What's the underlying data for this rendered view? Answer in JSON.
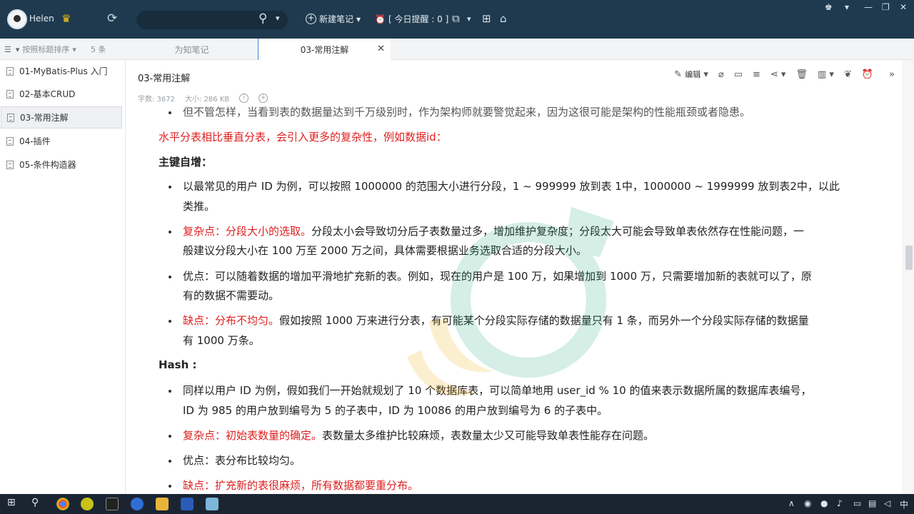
{
  "user": {
    "name": "Helen"
  },
  "header": {
    "new_note_label": "新建笔记",
    "reminder_label": "[ 今日提醒 : 0 ]"
  },
  "sortbar": {
    "sort_label": "按照标题排序",
    "count_label": "5 条"
  },
  "tabs": [
    {
      "label": "为知笔记"
    },
    {
      "label": "03-常用注解"
    }
  ],
  "notes": [
    {
      "label": "01-MyBatis-Plus 入门"
    },
    {
      "label": "02-基本CRUD"
    },
    {
      "label": "03-常用注解"
    },
    {
      "label": "04-插件"
    },
    {
      "label": "05-条件构造器"
    }
  ],
  "document": {
    "title": "03-常用注解",
    "word_count": "字数: 3672",
    "size": "大小: 286 KB",
    "edit_label": "编辑",
    "lines": {
      "l0": "但不管怎样，当看到表的数据量达到千万级别时，作为架构师就要警觉起来，因为这很可能是架构的性能瓶颈或者隐患。",
      "l1": "水平分表相比垂直分表，会引入更多的复杂性，例如数据id：",
      "l2": "主键自增：",
      "l3a": "以最常见的用户 ID 为例，可以按照 1000000 的范围大小进行分段，1 ~ 999999 放到表 1中，1000000 ~ 1999999 放到表2中，以此",
      "l3b": "类推。",
      "l4a_red": "复杂点：分段大小的选取。",
      "l4a": "分段太小会导致切分后子表数量过多，增加维护复杂度；分段太大可能会导致单表依然存在性能问题，一",
      "l4b": "般建议分段大小在 100 万至 2000 万之间，具体需要根据业务选取合适的分段大小。",
      "l5a": "优点：可以随着数据的增加平滑地扩充新的表。例如，现在的用户是 100 万，如果增加到 1000 万，只需要增加新的表就可以了，原",
      "l5b": "有的数据不需要动。",
      "l6a_red": "缺点：分布不均匀。",
      "l6a": "假如按照 1000 万来进行分表，有可能某个分段实际存储的数据量只有 1 条，而另外一个分段实际存储的数据量",
      "l6b": "有 1000 万条。",
      "l7": "Hash :",
      "l8a": "同样以用户 ID 为例，假如我们一开始就规划了 10 个数据库表，可以简单地用 user_id % 10 的值来表示数据所属的数据库表编号，",
      "l8b": "ID 为 985 的用户放到编号为 5 的子表中，ID 为 10086 的用户放到编号为 6 的子表中。",
      "l9_red": "复杂点：初始表数量的确定。",
      "l9": "表数量太多维护比较麻烦，表数量太少又可能导致单表性能存在问题。",
      "l10": "优点：表分布比较均匀。",
      "l11_red": "缺点：扩充新的表很麻烦，所有数据都要重分布。"
    }
  },
  "taskbar": {
    "ime_label": "中"
  }
}
